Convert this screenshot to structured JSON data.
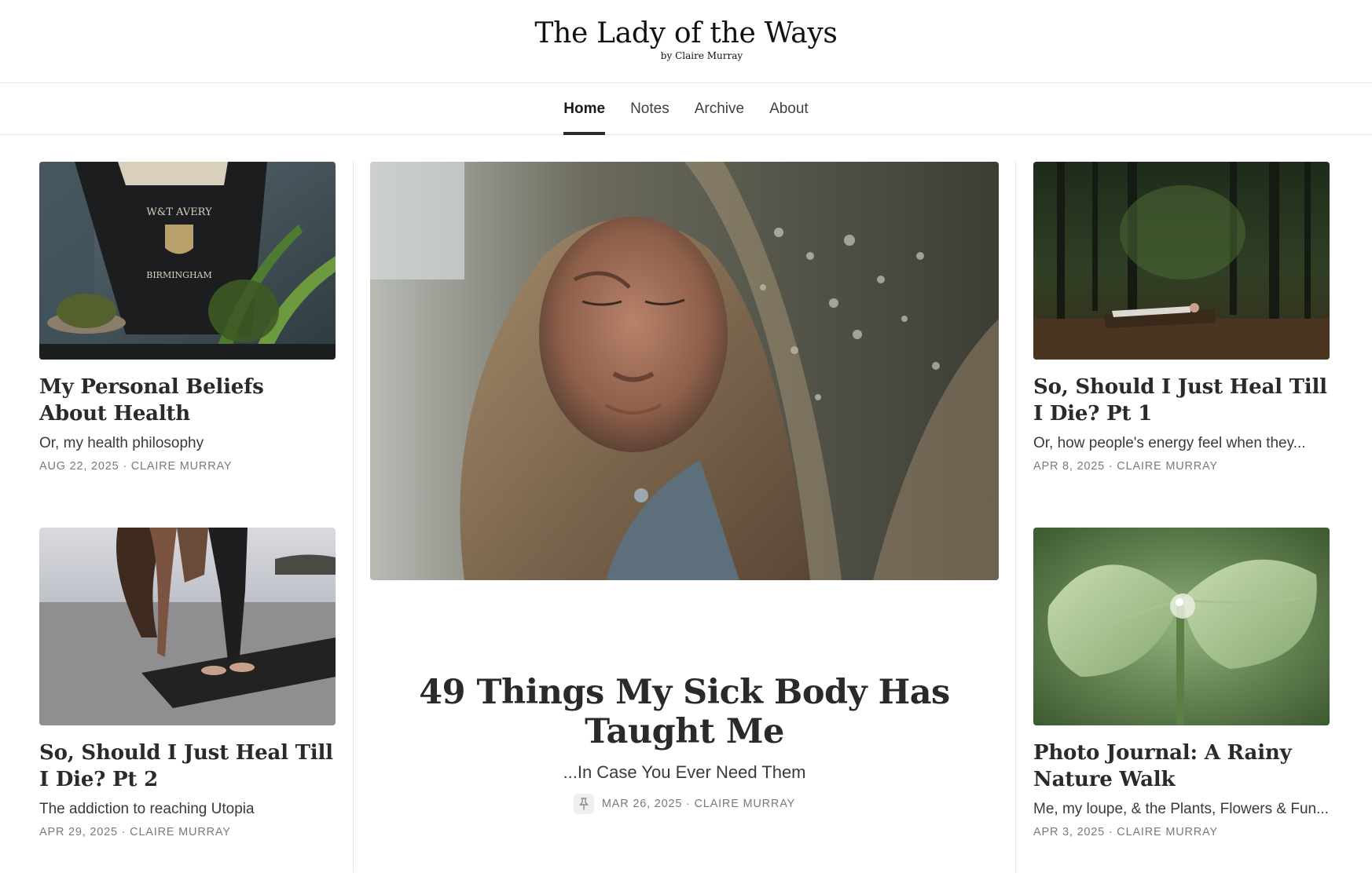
{
  "site": {
    "title": "The Lady of the Ways",
    "byline": "by Claire Murray"
  },
  "nav": {
    "items": [
      {
        "label": "Home",
        "active": true
      },
      {
        "label": "Notes",
        "active": false
      },
      {
        "label": "Archive",
        "active": false
      },
      {
        "label": "About",
        "active": false
      }
    ]
  },
  "posts": {
    "left_top": {
      "title": "My Personal Beliefs About Health",
      "subtitle": "Or, my health philosophy",
      "meta": "AUG 22, 2025 · CLAIRE MURRAY",
      "image": "antique-scale-plants-photo"
    },
    "left_bottom": {
      "title": "So, Should I Just Heal Till I Die? Pt 2",
      "subtitle": "The addiction to reaching Utopia",
      "meta": "APR 29, 2025 · CLAIRE MURRAY",
      "image": "yoga-beach-photo"
    },
    "featured": {
      "title": "49 Things My Sick Body Has Taught Me",
      "subtitle": "...In Case You Ever Need Them",
      "meta": "MAR 26, 2025 · CLAIRE MURRAY",
      "icon": "pin-icon",
      "image": "woman-face-overlay-photo"
    },
    "right_top": {
      "title": "So, Should I Just Heal Till I Die? Pt 1",
      "subtitle": "Or, how people's energy feel when they...",
      "meta": "APR 8, 2025 · CLAIRE MURRAY",
      "image": "forest-log-photo"
    },
    "right_bottom": {
      "title": "Photo Journal: A Rainy Nature Walk",
      "subtitle": "Me, my loupe, & the Plants, Flowers & Fun...",
      "meta": "APR 3, 2025 · CLAIRE MURRAY",
      "image": "green-leaf-droplet-photo"
    }
  },
  "colors": {
    "text": "#363737",
    "meta": "#7a7a7a",
    "divider": "#e6e6e6",
    "nav_indicator": "#2b2b2b"
  }
}
